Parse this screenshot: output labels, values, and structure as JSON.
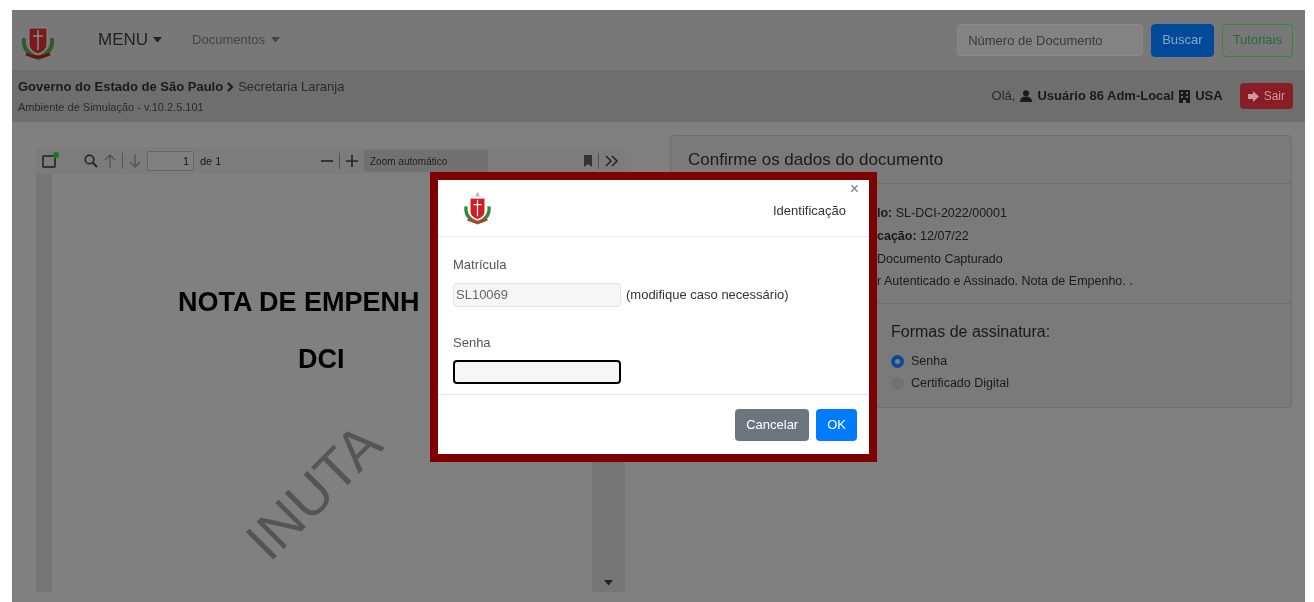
{
  "navbar": {
    "menu": "MENU",
    "documents": "Documentos",
    "search": {
      "placeholder": "Número de Documento"
    },
    "buttons": [
      {
        "label": "Buscar",
        "kind": "primary"
      },
      {
        "label": "Tutoriais",
        "kind": "outline"
      }
    ]
  },
  "header": {
    "breadcrumb": [
      "Governo do Estado de São Paulo",
      "Secretaria Laranja"
    ],
    "environment": "Ambiente de Simulação - v.10.2.5.101",
    "greeting": "Olá,",
    "user": "Usuário 86 Adm-Local",
    "unit": "USA",
    "logout": "Sair"
  },
  "pdf_viewer": {
    "page_input": "1",
    "page_count": "de 1",
    "zoom": "Zoom automático",
    "document": {
      "lines": [
        "NOTA DE EMPENH",
        "DCI"
      ],
      "watermark": "INUTA"
    }
  },
  "confirm_panel": {
    "title": "Confirme os dados do documento",
    "details": [
      "**lo:** SL-DCI-2022/00001",
      "**cação:** 12/07/22",
      "Documento Capturado",
      "r Autenticado e Assinado. Nota de Empenho. ."
    ],
    "signature_title": "Formas de assinatura:",
    "signature_options": [
      {
        "label": "Senha",
        "selected": true
      },
      {
        "label": "Certificado Digital",
        "selected": false
      }
    ]
  },
  "dialog": {
    "title": "Identificação",
    "close": "×",
    "fields": [
      {
        "label": "Matrícula",
        "value": "SL10069",
        "hint": "(modifique caso necessário)",
        "focused": false
      },
      {
        "label": "Senha",
        "focused": true
      }
    ],
    "buttons": [
      {
        "label": "Cancelar",
        "kind": "secondary"
      },
      {
        "label": "OK",
        "kind": "primary"
      }
    ]
  }
}
